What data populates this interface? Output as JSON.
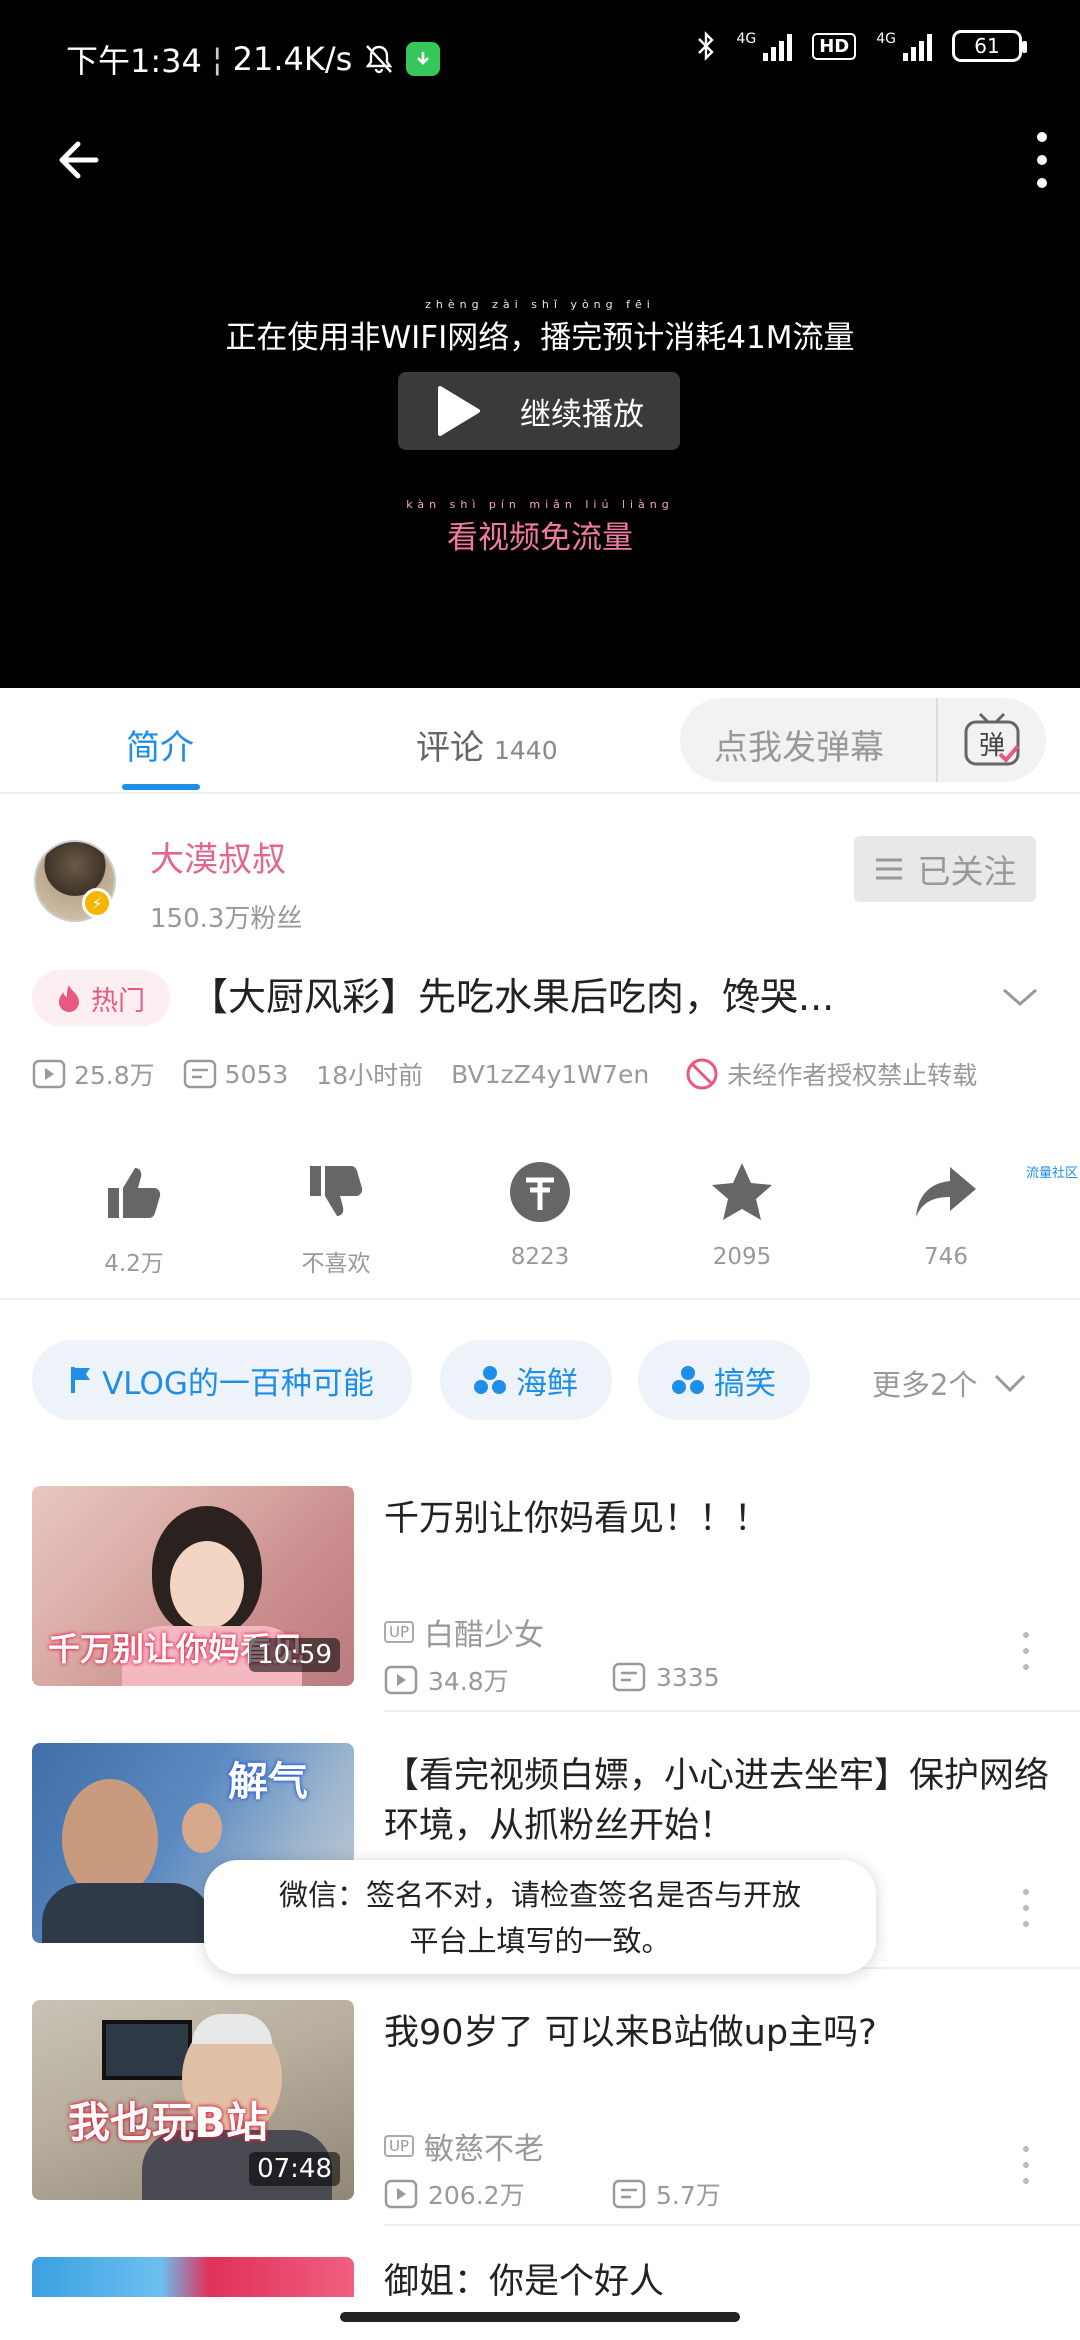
{
  "status_bar": {
    "time": "下午1:34",
    "net_speed": "21.4K/s",
    "network_1": "4G",
    "hd_label": "HD",
    "network_2": "4G",
    "battery": "61"
  },
  "player": {
    "warning": "正在使用非WIFI网络，播完预计消耗41M流量",
    "warning_pinyin": "zhèng zài shǐ yòng fēi",
    "continue_label": "继续播放",
    "free_traffic": "看视频免流量",
    "free_pinyin": "kàn shì pín miǎn liú liàng"
  },
  "tabs": {
    "intro": "简介",
    "comments": "评论",
    "comment_count": "1440",
    "danmu_placeholder": "点我发弹幕",
    "danmu_icon": "弹"
  },
  "uploader": {
    "name": "大漠叔叔",
    "fans": "150.3万粉丝",
    "follow_state": "已关注"
  },
  "video": {
    "hot_badge": "热门",
    "title": "【大厨风彩】先吃水果后吃肉，馋哭...",
    "views": "25.8万",
    "danmaku": "5053",
    "time_ago": "18小时前",
    "bvid": "BV1zZ4y1W7en",
    "repost_notice": "未经作者授权禁止转载"
  },
  "actions": {
    "like": "4.2万",
    "dislike": "不喜欢",
    "coin": "8223",
    "favorite": "2095",
    "share": "746",
    "side_link": "流量社区"
  },
  "tags": {
    "tag1": "VLOG的一百种可能",
    "tag2": "海鲜",
    "tag3": "搞笑",
    "more": "更多2个"
  },
  "recommendations": [
    {
      "title": "千万别让你妈看见！！！",
      "up": "白醋少女",
      "views": "34.8万",
      "danmaku": "3335",
      "duration": "10:59",
      "thumb_caption": "千万别让你妈看见"
    },
    {
      "title": "【看完视频白嫖，小心进去坐牢】保护网络环境，从抓粉丝开始！",
      "thumb_caption": "解气"
    },
    {
      "title": "我90岁了 可以来B站做up主吗?",
      "up": "敏慈不老",
      "views": "206.2万",
      "danmaku": "5.7万",
      "duration": "07:48",
      "thumb_caption": "我也玩B站"
    },
    {
      "title": "御姐：你是个好人"
    }
  ],
  "up_tag": "UP",
  "toast": {
    "line1": "微信：签名不对，请检查签名是否与开放",
    "line2": "平台上填写的一致。"
  },
  "colors": {
    "accent": "#1e8ee8",
    "pink": "#e4658d",
    "video_bg": "#000000"
  }
}
